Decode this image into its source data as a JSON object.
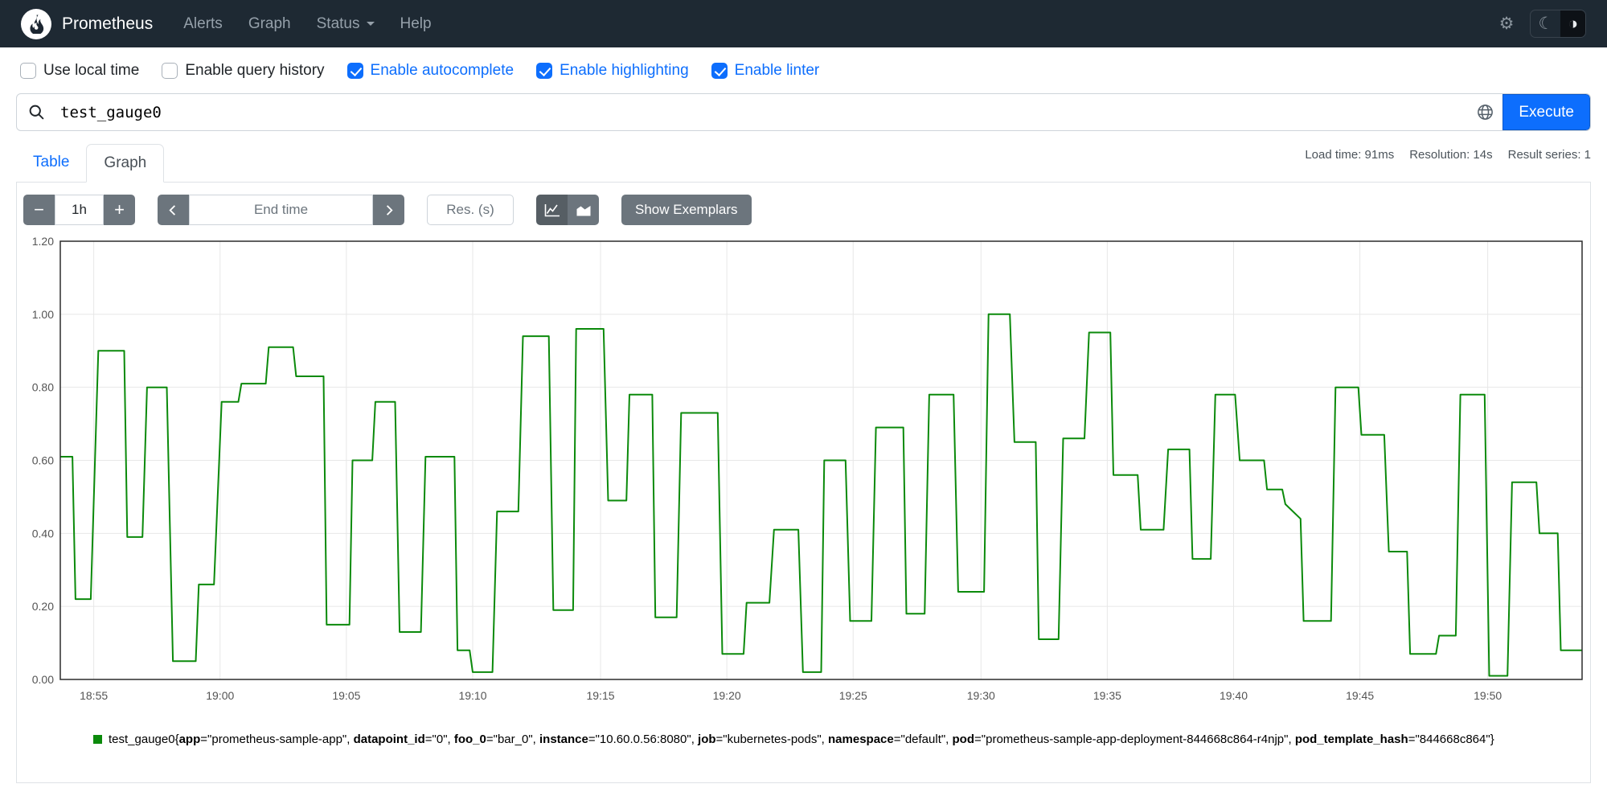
{
  "navbar": {
    "brand": "Prometheus",
    "items": [
      {
        "label": "Alerts"
      },
      {
        "label": "Graph"
      },
      {
        "label": "Status"
      },
      {
        "label": "Help"
      }
    ]
  },
  "options": [
    {
      "label": "Use local time",
      "checked": false
    },
    {
      "label": "Enable query history",
      "checked": false
    },
    {
      "label": "Enable autocomplete",
      "checked": true
    },
    {
      "label": "Enable highlighting",
      "checked": true
    },
    {
      "label": "Enable linter",
      "checked": true
    }
  ],
  "query": {
    "value": "test_gauge0",
    "execute_label": "Execute"
  },
  "stats": {
    "load_time": "Load time: 91ms",
    "resolution": "Resolution: 14s",
    "result_series": "Result series: 1"
  },
  "tabs": [
    {
      "label": "Table",
      "active": false
    },
    {
      "label": "Graph",
      "active": true
    }
  ],
  "graph_controls": {
    "minus": "−",
    "plus": "+",
    "range": "1h",
    "end_time_placeholder": "End time",
    "res_placeholder": "Res. (s)",
    "show_exemplars": "Show Exemplars"
  },
  "chart_data": {
    "type": "line",
    "title": "",
    "xlabel": "",
    "ylabel": "",
    "ylim": [
      0,
      1.2
    ],
    "grid": true,
    "x_range": [
      "18:53",
      "19:53"
    ],
    "x_ticks": [
      {
        "label": "18:55",
        "f": 0.022
      },
      {
        "label": "19:00",
        "f": 0.105
      },
      {
        "label": "19:05",
        "f": 0.188
      },
      {
        "label": "19:10",
        "f": 0.271
      },
      {
        "label": "19:15",
        "f": 0.355
      },
      {
        "label": "19:20",
        "f": 0.438
      },
      {
        "label": "19:25",
        "f": 0.521
      },
      {
        "label": "19:30",
        "f": 0.605
      },
      {
        "label": "19:35",
        "f": 0.688
      },
      {
        "label": "19:40",
        "f": 0.771
      },
      {
        "label": "19:45",
        "f": 0.854
      },
      {
        "label": "19:50",
        "f": 0.938
      }
    ],
    "y_ticks": [
      {
        "label": "0.00",
        "v": 0.0
      },
      {
        "label": "0.20",
        "v": 0.2
      },
      {
        "label": "0.40",
        "v": 0.4
      },
      {
        "label": "0.60",
        "v": 0.6
      },
      {
        "label": "0.80",
        "v": 0.8
      },
      {
        "label": "1.00",
        "v": 1.0
      },
      {
        "label": "1.20",
        "v": 1.2
      }
    ],
    "series": [
      {
        "name": "test_gauge0",
        "color": "#0b8a0b",
        "points": [
          [
            0,
            0.61
          ],
          [
            0.008,
            0.61
          ],
          [
            0.01,
            0.22
          ],
          [
            0.02,
            0.22
          ],
          [
            0.025,
            0.9
          ],
          [
            0.042,
            0.9
          ],
          [
            0.044,
            0.39
          ],
          [
            0.054,
            0.39
          ],
          [
            0.057,
            0.8
          ],
          [
            0.07,
            0.8
          ],
          [
            0.074,
            0.05
          ],
          [
            0.089,
            0.05
          ],
          [
            0.091,
            0.26
          ],
          [
            0.101,
            0.26
          ],
          [
            0.106,
            0.76
          ],
          [
            0.117,
            0.76
          ],
          [
            0.119,
            0.81
          ],
          [
            0.135,
            0.81
          ],
          [
            0.137,
            0.91
          ],
          [
            0.153,
            0.91
          ],
          [
            0.155,
            0.83
          ],
          [
            0.173,
            0.83
          ],
          [
            0.175,
            0.15
          ],
          [
            0.19,
            0.15
          ],
          [
            0.192,
            0.6
          ],
          [
            0.205,
            0.6
          ],
          [
            0.207,
            0.76
          ],
          [
            0.22,
            0.76
          ],
          [
            0.223,
            0.13
          ],
          [
            0.237,
            0.13
          ],
          [
            0.24,
            0.61
          ],
          [
            0.259,
            0.61
          ],
          [
            0.261,
            0.08
          ],
          [
            0.269,
            0.08
          ],
          [
            0.271,
            0.02
          ],
          [
            0.284,
            0.02
          ],
          [
            0.287,
            0.46
          ],
          [
            0.301,
            0.46
          ],
          [
            0.304,
            0.94
          ],
          [
            0.321,
            0.94
          ],
          [
            0.324,
            0.19
          ],
          [
            0.337,
            0.19
          ],
          [
            0.339,
            0.96
          ],
          [
            0.357,
            0.96
          ],
          [
            0.36,
            0.49
          ],
          [
            0.372,
            0.49
          ],
          [
            0.374,
            0.78
          ],
          [
            0.389,
            0.78
          ],
          [
            0.391,
            0.17
          ],
          [
            0.405,
            0.17
          ],
          [
            0.408,
            0.73
          ],
          [
            0.432,
            0.73
          ],
          [
            0.435,
            0.07
          ],
          [
            0.449,
            0.07
          ],
          [
            0.451,
            0.21
          ],
          [
            0.466,
            0.21
          ],
          [
            0.469,
            0.41
          ],
          [
            0.485,
            0.41
          ],
          [
            0.488,
            0.02
          ],
          [
            0.5,
            0.02
          ],
          [
            0.502,
            0.6
          ],
          [
            0.516,
            0.6
          ],
          [
            0.519,
            0.16
          ],
          [
            0.533,
            0.16
          ],
          [
            0.536,
            0.69
          ],
          [
            0.554,
            0.69
          ],
          [
            0.556,
            0.18
          ],
          [
            0.568,
            0.18
          ],
          [
            0.571,
            0.78
          ],
          [
            0.587,
            0.78
          ],
          [
            0.59,
            0.24
          ],
          [
            0.607,
            0.24
          ],
          [
            0.61,
            1
          ],
          [
            0.624,
            1
          ],
          [
            0.627,
            0.65
          ],
          [
            0.641,
            0.65
          ],
          [
            0.643,
            0.11
          ],
          [
            0.656,
            0.11
          ],
          [
            0.659,
            0.66
          ],
          [
            0.673,
            0.66
          ],
          [
            0.676,
            0.95
          ],
          [
            0.69,
            0.95
          ],
          [
            0.692,
            0.56
          ],
          [
            0.708,
            0.56
          ],
          [
            0.71,
            0.41
          ],
          [
            0.725,
            0.41
          ],
          [
            0.728,
            0.63
          ],
          [
            0.742,
            0.63
          ],
          [
            0.744,
            0.33
          ],
          [
            0.756,
            0.33
          ],
          [
            0.759,
            0.78
          ],
          [
            0.772,
            0.78
          ],
          [
            0.775,
            0.6
          ],
          [
            0.791,
            0.6
          ],
          [
            0.793,
            0.52
          ],
          [
            0.803,
            0.52
          ],
          [
            0.805,
            0.48
          ],
          [
            0.815,
            0.44
          ],
          [
            0.817,
            0.16
          ],
          [
            0.835,
            0.16
          ],
          [
            0.838,
            0.8
          ],
          [
            0.853,
            0.8
          ],
          [
            0.855,
            0.67
          ],
          [
            0.87,
            0.67
          ],
          [
            0.873,
            0.35
          ],
          [
            0.885,
            0.35
          ],
          [
            0.887,
            0.07
          ],
          [
            0.904,
            0.07
          ],
          [
            0.906,
            0.12
          ],
          [
            0.917,
            0.12
          ],
          [
            0.92,
            0.78
          ],
          [
            0.936,
            0.78
          ],
          [
            0.939,
            0.01
          ],
          [
            0.951,
            0.01
          ],
          [
            0.954,
            0.54
          ],
          [
            0.97,
            0.54
          ],
          [
            0.972,
            0.4
          ],
          [
            0.984,
            0.4
          ],
          [
            0.986,
            0.08
          ],
          [
            1,
            0.08
          ]
        ]
      }
    ]
  },
  "legend": {
    "metric": "test_gauge0",
    "labels": [
      {
        "name": "app",
        "value": "prometheus-sample-app"
      },
      {
        "name": "datapoint_id",
        "value": "0"
      },
      {
        "name": "foo_0",
        "value": "bar_0"
      },
      {
        "name": "instance",
        "value": "10.60.0.56:8080"
      },
      {
        "name": "job",
        "value": "kubernetes-pods"
      },
      {
        "name": "namespace",
        "value": "default"
      },
      {
        "name": "pod",
        "value": "prometheus-sample-app-deployment-844668c864-r4njp"
      },
      {
        "name": "pod_template_hash",
        "value": "844668c864"
      }
    ]
  }
}
